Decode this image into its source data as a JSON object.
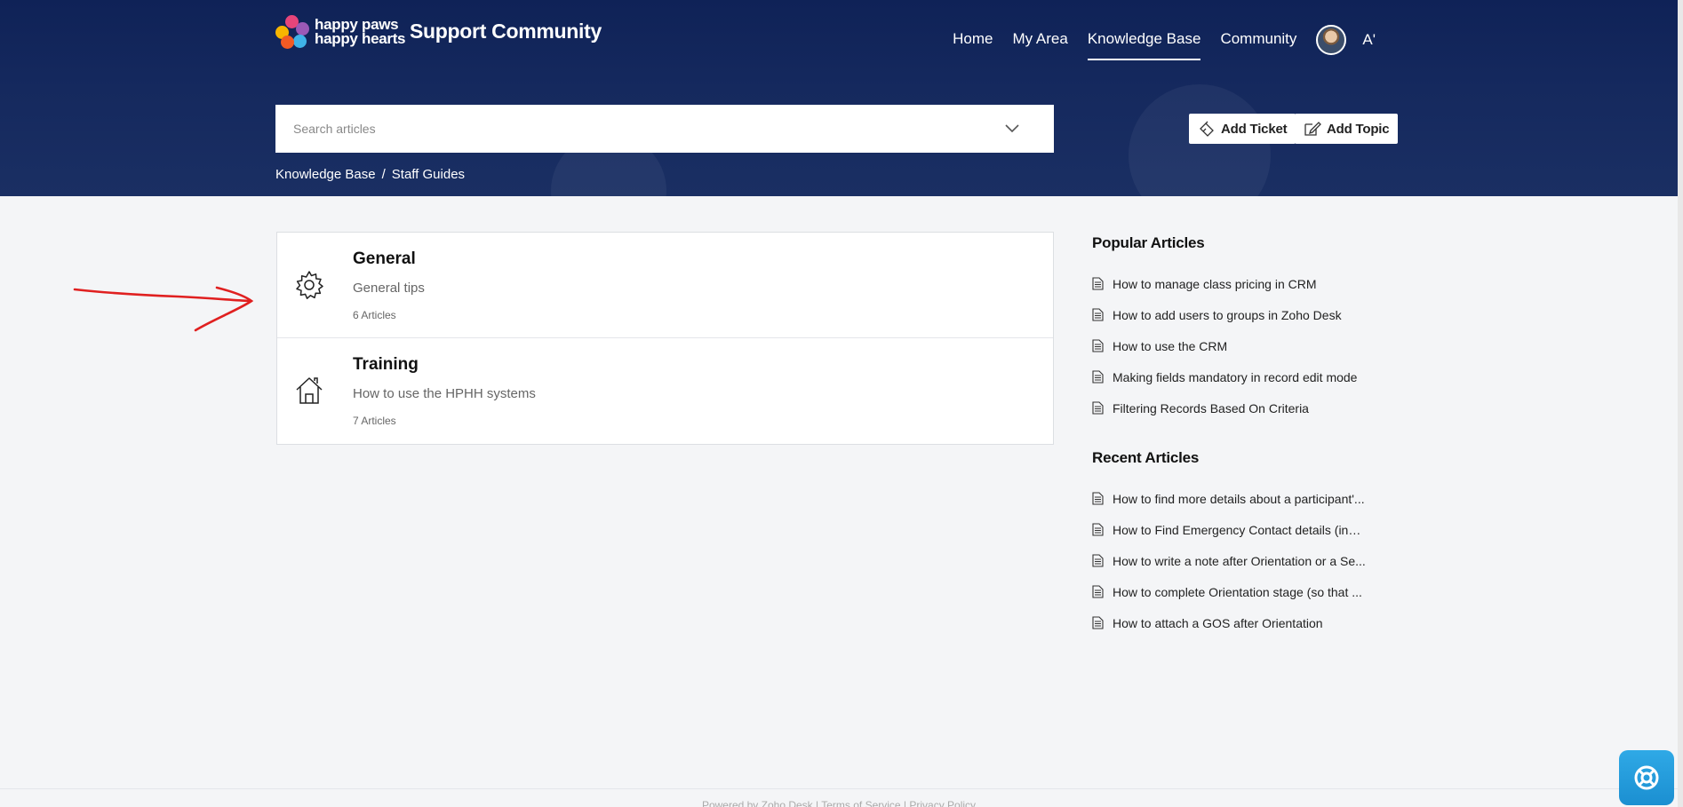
{
  "brand": {
    "logo_line1": "happy paws",
    "logo_line2": "happy hearts",
    "site_title": "Support Community"
  },
  "nav": {
    "items": [
      {
        "label": "Home",
        "active": false
      },
      {
        "label": "My Area",
        "active": false
      },
      {
        "label": "Knowledge Base",
        "active": true
      },
      {
        "label": "Community",
        "active": false
      }
    ],
    "lang_label": "A'"
  },
  "search": {
    "placeholder": "Search articles",
    "value": ""
  },
  "actions": {
    "add_ticket": "Add Ticket",
    "add_topic": "Add Topic"
  },
  "breadcrumb": {
    "root": "Knowledge Base",
    "separator": "/",
    "current": "Staff Guides"
  },
  "categories": [
    {
      "title": "General",
      "description": "General tips",
      "count": "6 Articles",
      "icon": "gear-icon"
    },
    {
      "title": "Training",
      "description": "How to use the HPHH systems",
      "count": "7 Articles",
      "icon": "house-icon"
    }
  ],
  "popular": {
    "heading": "Popular Articles",
    "items": [
      "How to manage class pricing in CRM",
      "How to add users to groups in Zoho Desk",
      "How to use the CRM",
      "Making fields mandatory in record edit mode",
      "Filtering Records Based On Criteria"
    ]
  },
  "recent": {
    "heading": "Recent Articles",
    "items": [
      "How to find more details about a participant'...",
      "How to Find Emergency Contact details (incl...",
      "How to write a note after Orientation or a Se...",
      "How to complete Orientation stage (so that ...",
      "How to attach a GOS after Orientation"
    ]
  },
  "footer": {
    "text": "Powered by Zoho Desk | Terms of Service | Privacy Policy"
  },
  "colors": {
    "header_bg": "#15295e",
    "annotation": "#e02020",
    "help_button": "#1b8fd1"
  }
}
